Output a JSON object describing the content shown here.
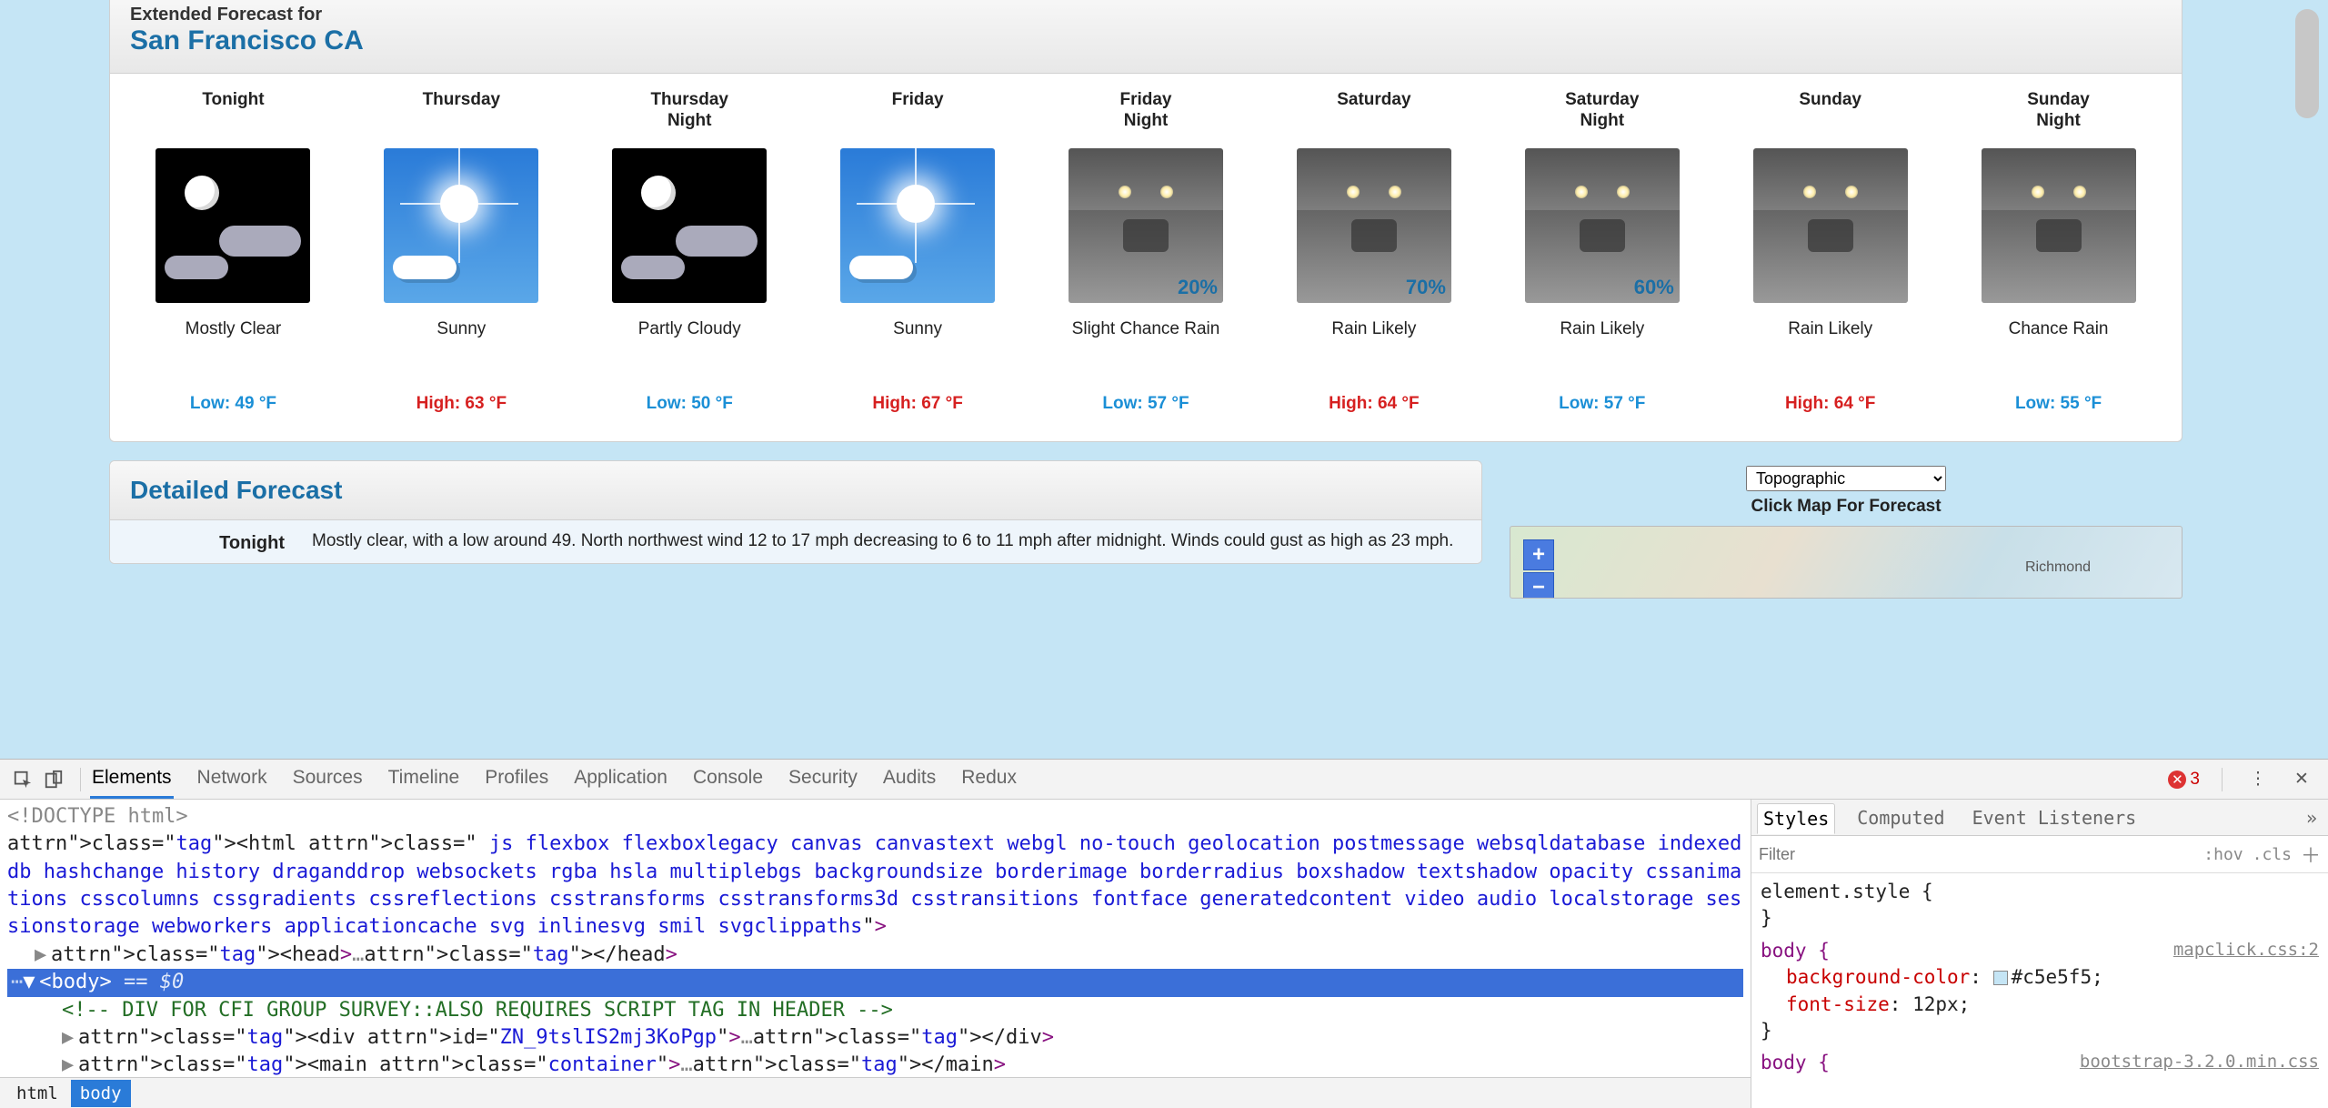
{
  "forecast_panel": {
    "subtitle": "Extended Forecast for",
    "location": "San Francisco CA"
  },
  "forecast": [
    {
      "period": "Tonight",
      "period2": "",
      "iconType": "night-clear",
      "prob": "",
      "cond": "Mostly Clear",
      "tempLabel": "Low: 49 °F",
      "tempClass": "low"
    },
    {
      "period": "Thursday",
      "period2": "",
      "iconType": "day-sunny",
      "prob": "",
      "cond": "Sunny",
      "tempLabel": "High: 63 °F",
      "tempClass": "high"
    },
    {
      "period": "Thursday",
      "period2": "Night",
      "iconType": "night-partly",
      "prob": "",
      "cond": "Partly Cloudy",
      "tempLabel": "Low: 50 °F",
      "tempClass": "low"
    },
    {
      "period": "Friday",
      "period2": "",
      "iconType": "day-sunny",
      "prob": "",
      "cond": "Sunny",
      "tempLabel": "High: 67 °F",
      "tempClass": "high"
    },
    {
      "period": "Friday",
      "period2": "Night",
      "iconType": "rain",
      "prob": "20%",
      "cond": "Slight Chance Rain",
      "tempLabel": "Low: 57 °F",
      "tempClass": "low"
    },
    {
      "period": "Saturday",
      "period2": "",
      "iconType": "rain",
      "prob": "70%",
      "cond": "Rain Likely",
      "tempLabel": "High: 64 °F",
      "tempClass": "high"
    },
    {
      "period": "Saturday",
      "period2": "Night",
      "iconType": "rain",
      "prob": "60%",
      "cond": "Rain Likely",
      "tempLabel": "Low: 57 °F",
      "tempClass": "low"
    },
    {
      "period": "Sunday",
      "period2": "",
      "iconType": "rain",
      "prob": "",
      "cond": "Rain Likely",
      "tempLabel": "High: 64 °F",
      "tempClass": "high"
    },
    {
      "period": "Sunday",
      "period2": "Night",
      "iconType": "rain",
      "prob": "",
      "cond": "Chance Rain",
      "tempLabel": "Low: 55 °F",
      "tempClass": "low"
    }
  ],
  "detailed": {
    "title": "Detailed Forecast",
    "rows": [
      {
        "label": "Tonight",
        "text": "Mostly clear, with a low around 49. North northwest wind 12 to 17 mph decreasing to 6 to 11 mph after midnight. Winds could gust as high as 23 mph."
      }
    ]
  },
  "mapcol": {
    "select_value": "Topographic",
    "hint": "Click Map For Forecast",
    "zoom_in": "+",
    "zoom_out": "−",
    "labels": {
      "richmond": "Richmond"
    }
  },
  "devtools": {
    "tabs": [
      "Elements",
      "Network",
      "Sources",
      "Timeline",
      "Profiles",
      "Application",
      "Console",
      "Security",
      "Audits",
      "Redux"
    ],
    "active_tab": "Elements",
    "error_count": "3",
    "dom": {
      "doctype": "<!DOCTYPE html>",
      "html_open": "<html class=\" js flexbox flexboxlegacy canvas canvastext webgl no-touch geolocation postmessage websqldatabase indexeddb hashchange history draganddrop websockets rgba hsla multiplebgs backgroundsize borderimage borderradius boxshadow textshadow opacity cssanimations csscolumns cssgradients cssreflections csstransforms csstransforms3d csstransitions fontface generatedcontent video audio localstorage sessionstorage webworkers applicationcache svg inlinesvg smil svgclippaths\">",
      "head": "<head>…</head>",
      "body_sel": "<body> == $0",
      "comment": "<!-- DIV FOR CFI GROUP SURVEY::ALSO REQUIRES SCRIPT TAG IN HEADER -->",
      "div": "<div id=\"ZN_9tslIS2mj3KoPgp\">…</div>",
      "main": "<main class=\"container\">…</main>"
    },
    "crumbs": [
      "html",
      "body"
    ],
    "crumb_selected": "body",
    "side_tabs": [
      "Styles",
      "Computed",
      "Event Listeners"
    ],
    "side_active": "Styles",
    "filter_placeholder": "Filter",
    "hov": ":hov",
    "cls": ".cls",
    "styles": {
      "element_style": "element.style {",
      "brace_close": "}",
      "body_sel": "body {",
      "body_src": "mapclick.css:2",
      "bg_prop": "background-color",
      "bg_val": "#c5e5f5",
      "bg_swatch": "#c5e5f5",
      "fs_prop": "font-size",
      "fs_val": "12px",
      "body2_sel": "body {",
      "body2_src": "bootstrap-3.2.0.min.css"
    }
  }
}
